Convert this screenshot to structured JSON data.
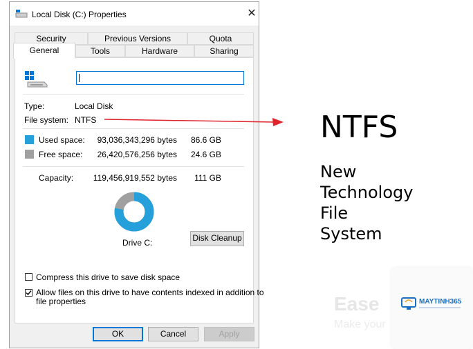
{
  "window": {
    "title": "Local Disk (C:) Properties",
    "close_glyph": "✕"
  },
  "tabs_row1": [
    {
      "label": "Security"
    },
    {
      "label": "Previous Versions"
    },
    {
      "label": "Quota"
    }
  ],
  "tabs_row2": [
    {
      "label": "General",
      "active": true
    },
    {
      "label": "Tools"
    },
    {
      "label": "Hardware"
    },
    {
      "label": "Sharing"
    }
  ],
  "general": {
    "drive_name_value": "",
    "type_label": "Type:",
    "type_value": "Local Disk",
    "fs_label": "File system:",
    "fs_value": "NTFS",
    "used_label": "Used space:",
    "used_bytes": "93,036,343,296 bytes",
    "used_gb": "86.6 GB",
    "free_label": "Free space:",
    "free_bytes": "26,420,576,256 bytes",
    "free_gb": "24.6 GB",
    "capacity_label": "Capacity:",
    "capacity_bytes": "119,456,919,552 bytes",
    "capacity_gb": "111 GB",
    "drive_caption": "Drive C:",
    "used_fraction": 0.779,
    "disk_cleanup_label": "Disk Cleanup",
    "compress_label": "Compress this drive to save disk space",
    "compress_checked": false,
    "index_label_line1": "Allow files on this drive to have contents indexed in addition to",
    "index_label_line2": "file properties",
    "index_checked": true
  },
  "buttons": {
    "ok": "OK",
    "cancel": "Cancel",
    "apply": "Apply"
  },
  "annotation": {
    "heading": "NTFS",
    "lines": [
      "New",
      "Technology",
      "File",
      "System"
    ]
  },
  "watermark": {
    "brand": "MAYTINH365",
    "faded_word1": "Ease",
    "faded_word2": "Make your"
  },
  "colors": {
    "used": "#26a0da",
    "free": "#a0a0a0",
    "arrow": "#e0242b",
    "accent": "#0078d7"
  },
  "icons": {
    "drive": "hard-drive-windows-icon",
    "check": "checkmark-icon"
  }
}
